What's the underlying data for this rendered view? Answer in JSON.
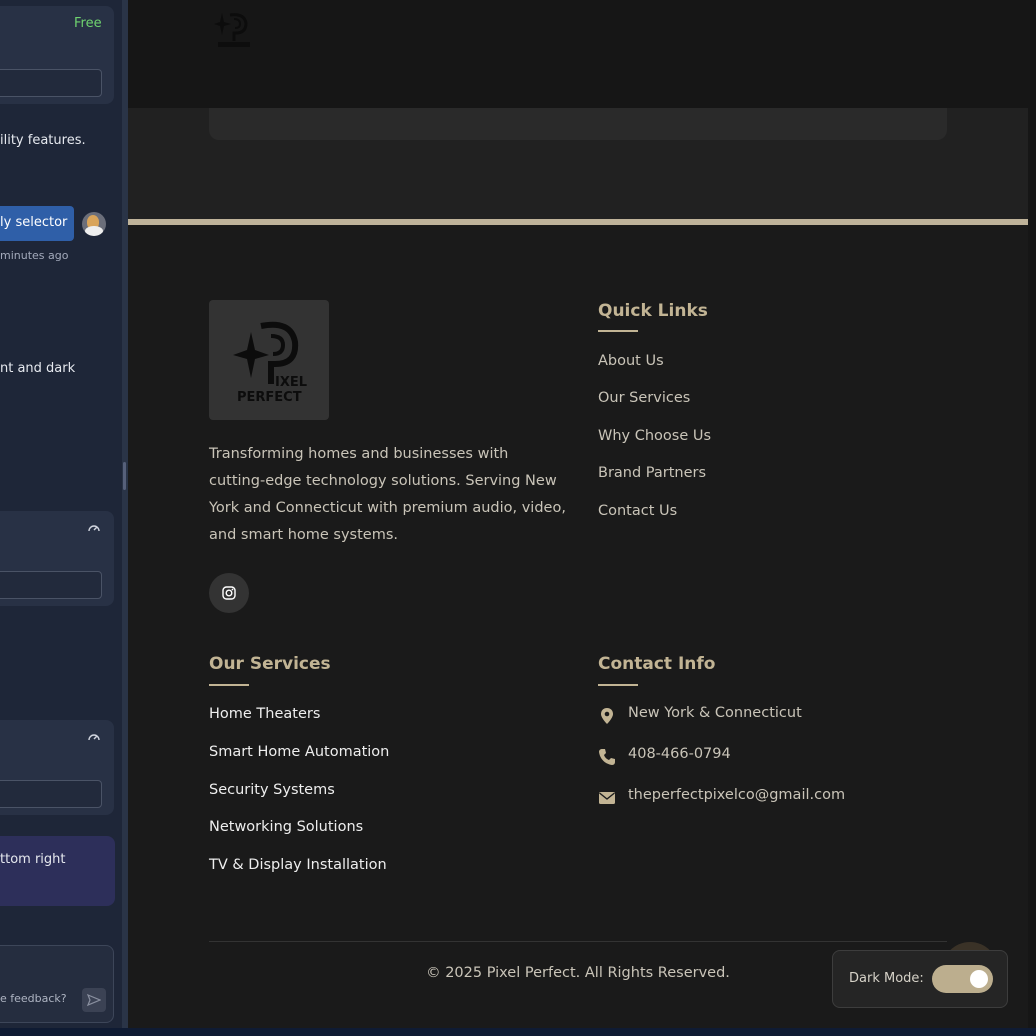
{
  "chat_panel": {
    "plan_badge": "Free",
    "feature_text": "ility features.",
    "chip_label": "ly selector",
    "chip_time": "minutes ago",
    "dark_text": "nt and dark",
    "position_text": "ttom right",
    "feedback_placeholder": "e feedback?",
    "colors": {
      "badge": "#6fd36f",
      "chip": "#2f5fa8",
      "highlight_card": "#2d2f5a"
    }
  },
  "site": {
    "brand": "Pixel Perfect",
    "footer": {
      "description": "Transforming homes and businesses with cutting-edge technology solutions. Serving New York and Connecticut with premium audio, video, and smart home systems.",
      "social_icon": "instagram-icon",
      "quick_links": {
        "heading": "Quick Links",
        "items": [
          "About Us",
          "Our Services",
          "Why Choose Us",
          "Brand Partners",
          "Contact Us"
        ]
      },
      "services": {
        "heading": "Our Services",
        "items": [
          "Home Theaters",
          "Smart Home Automation",
          "Security Systems",
          "Networking Solutions",
          "TV & Display Installation"
        ]
      },
      "contact": {
        "heading": "Contact Info",
        "location": "New York & Connecticut",
        "phone": "408-466-0794",
        "email": "theperfectpixelco@gmail.com",
        "icons": [
          "map-pin-icon",
          "phone-icon",
          "envelope-icon"
        ]
      },
      "copyright": "© 2025 Pixel Perfect. All Rights Reserved."
    },
    "dark_mode": {
      "label": "Dark Mode:",
      "enabled": true
    },
    "colors": {
      "accent": "#c2b494",
      "background": "#1a1a1a",
      "toggle": "#bcae8e"
    }
  }
}
